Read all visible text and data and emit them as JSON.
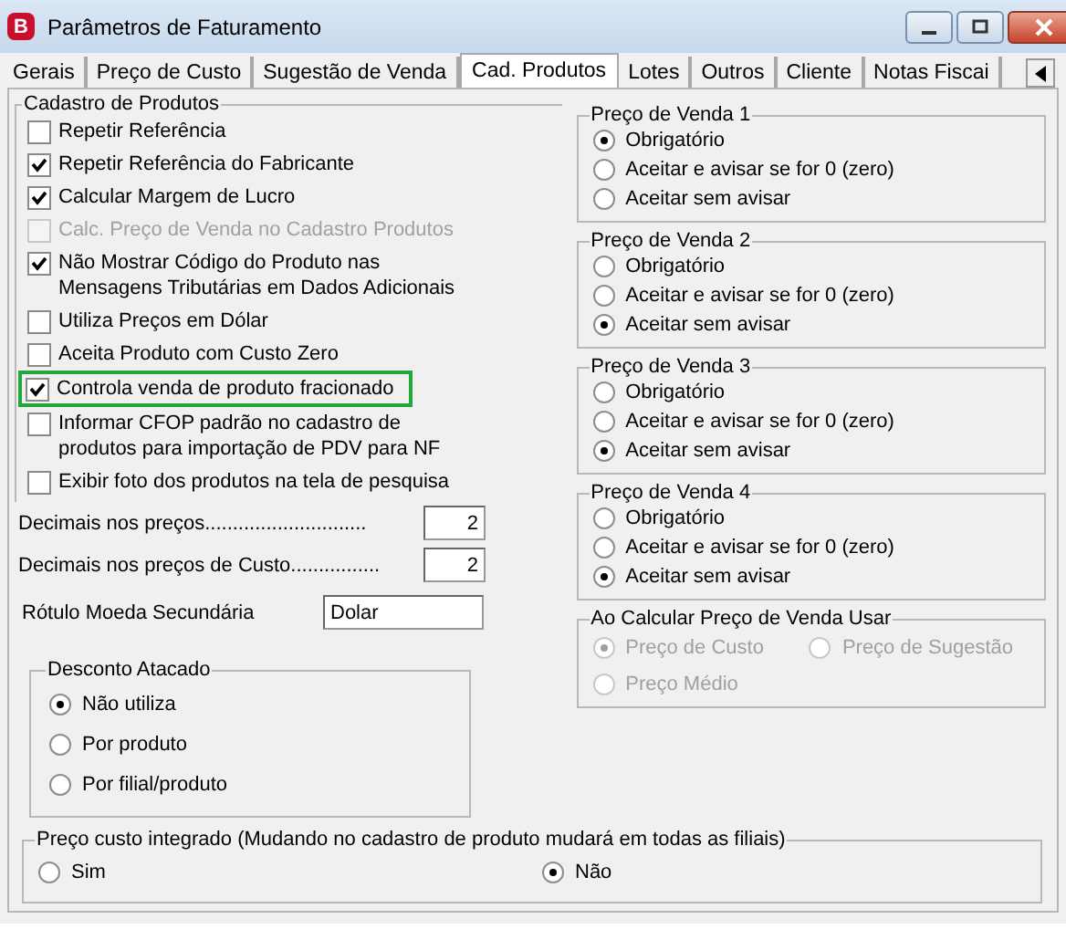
{
  "window": {
    "title": "Parâmetros de Faturamento",
    "app_letter": "B"
  },
  "tabs": [
    {
      "label": "Gerais",
      "selected": false
    },
    {
      "label": "Preço de Custo",
      "selected": false
    },
    {
      "label": "Sugestão de  Venda",
      "selected": false
    },
    {
      "label": "Cad. Produtos",
      "selected": true
    },
    {
      "label": "Lotes",
      "selected": false
    },
    {
      "label": "Outros",
      "selected": false
    },
    {
      "label": "Cliente",
      "selected": false
    },
    {
      "label": "Notas Fiscai",
      "selected": false
    }
  ],
  "cadastro": {
    "title": "Cadastro de Produtos",
    "options": [
      {
        "label": "Repetir Referência",
        "checked": false,
        "disabled": false,
        "highlighted": false
      },
      {
        "label": "Repetir Referência do Fabricante",
        "checked": true,
        "disabled": false,
        "highlighted": false
      },
      {
        "label": "Calcular Margem de Lucro",
        "checked": true,
        "disabled": false,
        "highlighted": false
      },
      {
        "label": "Calc. Preço de Venda no Cadastro Produtos",
        "checked": false,
        "disabled": true,
        "highlighted": false
      },
      {
        "label": "Não Mostrar Código do Produto nas Mensagens Tributárias em Dados Adicionais",
        "checked": true,
        "disabled": false,
        "highlighted": false
      },
      {
        "label": "Utiliza Preços em Dólar",
        "checked": false,
        "disabled": false,
        "highlighted": false
      },
      {
        "label": "Aceita Produto com Custo Zero",
        "checked": false,
        "disabled": false,
        "highlighted": false
      },
      {
        "label": "Controla venda de produto fracionado",
        "checked": true,
        "disabled": false,
        "highlighted": true
      },
      {
        "label": "Informar CFOP padrão no cadastro de produtos para importação de PDV para NF",
        "checked": false,
        "disabled": false,
        "highlighted": false
      },
      {
        "label": "Exibir foto dos produtos na tela de pesquisa",
        "checked": false,
        "disabled": false,
        "highlighted": false
      }
    ],
    "fields": [
      {
        "label": "Decimais nos preços.............................",
        "value": "2",
        "kind": "number"
      },
      {
        "label": "Decimais nos preços de Custo................",
        "value": "2",
        "kind": "number"
      },
      {
        "label": "Rótulo Moeda Secundária",
        "value": "Dolar",
        "kind": "text"
      }
    ]
  },
  "desconto": {
    "title": "Desconto Atacado",
    "options": [
      {
        "label": "Não utiliza",
        "selected": true
      },
      {
        "label": "Por produto",
        "selected": false
      },
      {
        "label": "Por filial/produto",
        "selected": false
      }
    ]
  },
  "preco_venda": [
    {
      "title": "Preço de Venda 1",
      "options": [
        {
          "label": "Obrigatório",
          "selected": true
        },
        {
          "label": "Aceitar e avisar se for 0 (zero)",
          "selected": false
        },
        {
          "label": "Aceitar sem avisar",
          "selected": false
        }
      ]
    },
    {
      "title": "Preço de Venda 2",
      "options": [
        {
          "label": "Obrigatório",
          "selected": false
        },
        {
          "label": "Aceitar e avisar se for 0 (zero)",
          "selected": false
        },
        {
          "label": "Aceitar sem avisar",
          "selected": true
        }
      ]
    },
    {
      "title": "Preço de Venda 3",
      "options": [
        {
          "label": "Obrigatório",
          "selected": false
        },
        {
          "label": "Aceitar e avisar se for 0 (zero)",
          "selected": false
        },
        {
          "label": "Aceitar sem avisar",
          "selected": true
        }
      ]
    },
    {
      "title": "Preço de Venda 4",
      "options": [
        {
          "label": "Obrigatório",
          "selected": false
        },
        {
          "label": "Aceitar e avisar se for 0 (zero)",
          "selected": false
        },
        {
          "label": "Aceitar sem avisar",
          "selected": true
        }
      ]
    }
  ],
  "ao_calcular": {
    "title": "Ao Calcular Preço de Venda Usar",
    "disabled": true,
    "options": [
      {
        "label": "Preço de Custo",
        "selected": true
      },
      {
        "label": "Preço de Sugestão",
        "selected": false
      },
      {
        "label": "Preço Médio",
        "selected": false
      }
    ]
  },
  "preco_integrado": {
    "title": "Preço custo integrado (Mudando no cadastro de produto mudará em todas as filiais)",
    "options": [
      {
        "label": "Sim",
        "selected": false
      },
      {
        "label": "Não",
        "selected": true
      }
    ]
  }
}
